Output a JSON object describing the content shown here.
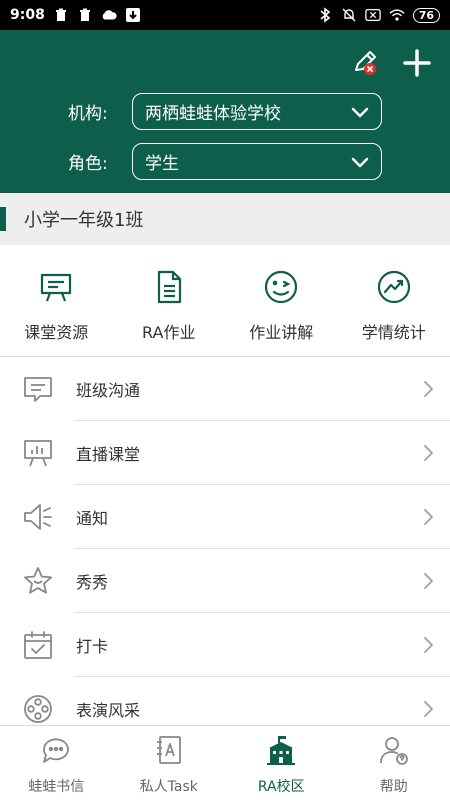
{
  "status_bar": {
    "time": "9:08",
    "battery": "76"
  },
  "header": {
    "org_label": "机构:",
    "org_value": "两栖蛙蛙体验学校",
    "role_label": "角色:",
    "role_value": "学生"
  },
  "class_bar": {
    "title": "小学一年级1班"
  },
  "quick_grid": [
    {
      "label": "课堂资源",
      "icon": "presentation-board-icon"
    },
    {
      "label": "RA作业",
      "icon": "document-icon"
    },
    {
      "label": "作业讲解",
      "icon": "wink-face-icon"
    },
    {
      "label": "学情统计",
      "icon": "trend-chart-icon"
    }
  ],
  "list": [
    {
      "label": "班级沟通",
      "icon": "chat-icon"
    },
    {
      "label": "直播课堂",
      "icon": "live-class-icon"
    },
    {
      "label": "通知",
      "icon": "speaker-icon"
    },
    {
      "label": "秀秀",
      "icon": "star-icon"
    },
    {
      "label": "打卡",
      "icon": "calendar-check-icon"
    },
    {
      "label": "表演风采",
      "icon": "film-reel-icon"
    }
  ],
  "tabs": [
    {
      "label": "蛙蛙书信",
      "icon": "chat-bubbles-icon",
      "active": false
    },
    {
      "label": "私人Task",
      "icon": "notebook-a-icon",
      "active": false
    },
    {
      "label": "RA校区",
      "icon": "school-building-icon",
      "active": true
    },
    {
      "label": "帮助",
      "icon": "user-help-icon",
      "active": false
    }
  ],
  "colors": {
    "primary": "#0d5e4a",
    "badge_red": "#e0312f"
  }
}
